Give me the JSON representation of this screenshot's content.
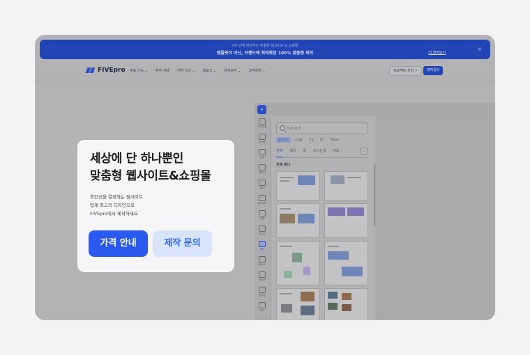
{
  "banner": {
    "sub": "2주 만에 완성하는 맞춤형 웹사이트 & 쇼핑몰",
    "main": "템플릿이 아닌, 브랜드에 최적화된 100% 맞춤형 제작",
    "more_link": "더 알아보기",
    "close": "×"
  },
  "header": {
    "logo": "FIVEpro",
    "nav": [
      "주요 기능 ⌄",
      "제작 사례",
      "가격 안내 ⌄",
      "블로그 ⌄",
      "유지보수 ⌄",
      "고객지원 ⌄"
    ],
    "project_button": "프로젝트 관리 ⇗",
    "make_button": "제작문의"
  },
  "editor": {
    "collapse": "«",
    "tools": [
      "사이트맵",
      "도메인",
      "전원",
      "페이지",
      "폴더",
      "슬라이드",
      "상품",
      "게시판",
      "배너",
      "텍스트",
      "게시판",
      "동영상",
      "지도"
    ],
    "active_tool_index": 8,
    "search_placeholder": "전체 검색",
    "filters": [
      "플레이스",
      "쇼핑몰",
      "기업",
      "PC",
      "Mobile"
    ],
    "categories": [
      "전체",
      "배너",
      "위",
      "오시는길",
      "지도"
    ],
    "next": "›",
    "section_title": "전체 배너"
  },
  "hero": {
    "title_line1": "세상에 단 하나뿐인",
    "title_line2": "맞춤형 웹사이트&쇼핑몰",
    "desc_line1": "첫인상을 결정하는 웹사이트",
    "desc_line2": "업계 최고의 디자인으로",
    "desc_line3": "FIVEpro에서 제작하세요",
    "primary_button": "가격 안내",
    "secondary_button": "제작 문의"
  },
  "colors": {
    "accent": "#2a5af0",
    "accent_light": "#d7e4fc",
    "banner": "#2244b4"
  }
}
